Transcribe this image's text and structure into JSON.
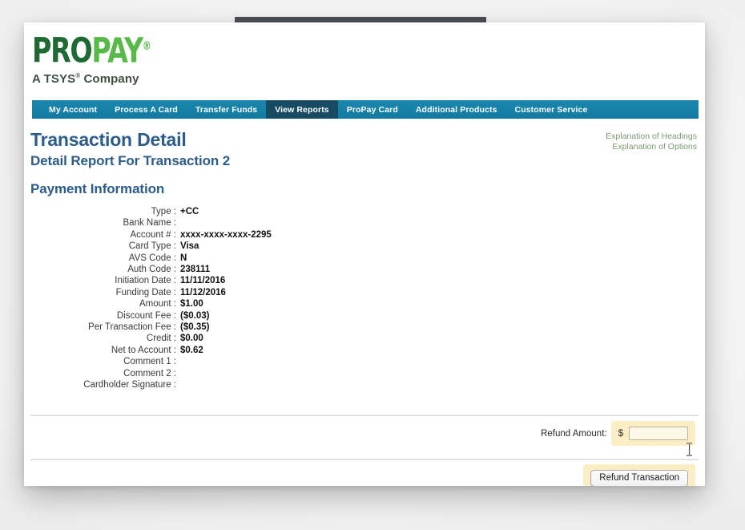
{
  "brand": {
    "logo_part1": "PRO",
    "logo_part2": "PAY",
    "registered_mark": "®",
    "tagline_pre": "A TSYS",
    "tagline_sup": "®",
    "tagline_post": " Company"
  },
  "nav": {
    "items": [
      {
        "label": "My Account",
        "active": false
      },
      {
        "label": "Process A Card",
        "active": false
      },
      {
        "label": "Transfer Funds",
        "active": false
      },
      {
        "label": "View Reports",
        "active": true
      },
      {
        "label": "ProPay Card",
        "active": false
      },
      {
        "label": "Additional Products",
        "active": false
      },
      {
        "label": "Customer Service",
        "active": false
      }
    ],
    "active_index": 3,
    "bar_color": "#1781a8",
    "active_color": "#174a63"
  },
  "header": {
    "title": "Transaction Detail",
    "subtitle": "Detail Report For Transaction 2",
    "title_color": "#2b5c8a",
    "links": [
      {
        "label": "Explanation of Headings"
      },
      {
        "label": "Explanation of Options"
      }
    ],
    "link_color": "#7a9b73"
  },
  "payment_information": {
    "section_title": "Payment Information",
    "fields": [
      {
        "label": "Type :",
        "value": "+CC"
      },
      {
        "label": "Bank Name :",
        "value": ""
      },
      {
        "label": "Account # :",
        "value": "xxxx-xxxx-xxxx-2295"
      },
      {
        "label": "Card Type :",
        "value": "Visa"
      },
      {
        "label": "AVS Code :",
        "value": "N"
      },
      {
        "label": "Auth Code :",
        "value": "238111"
      },
      {
        "label": "Initiation Date :",
        "value": "11/11/2016"
      },
      {
        "label": "Funding Date :",
        "value": "11/12/2016"
      },
      {
        "label": "Amount :",
        "value": "$1.00"
      },
      {
        "label": "Discount Fee :",
        "value": "($0.03)"
      },
      {
        "label": "Per Transaction Fee :",
        "value": "($0.35)"
      },
      {
        "label": "Credit :",
        "value": "$0.00"
      },
      {
        "label": "Net to Account :",
        "value": "$0.62"
      },
      {
        "label": "Comment 1 :",
        "value": ""
      },
      {
        "label": "Comment 2 :",
        "value": ""
      },
      {
        "label": "Cardholder Signature :",
        "value": ""
      }
    ]
  },
  "refund": {
    "amount_label": "Refund Amount:",
    "currency_symbol": "$",
    "amount_value": "",
    "amount_placeholder": "",
    "button_label": "Refund Transaction",
    "highlight_color": "#fbeec4"
  }
}
